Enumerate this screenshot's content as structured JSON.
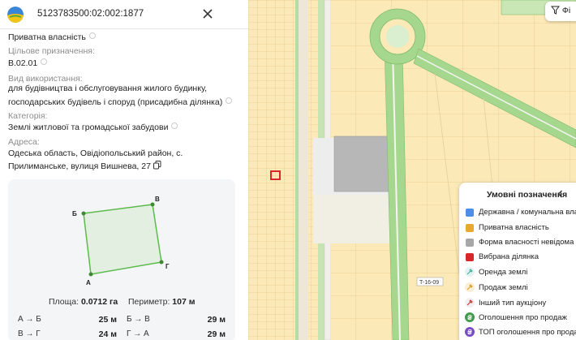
{
  "panel": {
    "cadastral_number": "5123783500:02:002:1877",
    "ownership": "Приватна власність",
    "purpose_label": "Цільове призначення:",
    "purpose_code": "В.02.01",
    "usage_label": "Вид використання:",
    "usage_line1": "для будівництва і обслуговування жилого будинку,",
    "usage_line2": "господарських будівель і споруд (присадибна ділянка)",
    "category_label": "Категорія:",
    "category_value": "Землі житлової та громадської забудови",
    "address_label": "Адреса:",
    "address_line1": "Одеська область, Овідіопольський район, с.",
    "address_line2": "Прилиманське, вулиця Вишнева, 27",
    "shape": {
      "vertices": [
        "Б",
        "В",
        "Г",
        "А"
      ],
      "area_label": "Площа:",
      "area_value": "0.0712 га",
      "perimeter_label": "Периметр:",
      "perimeter_value": "107 м",
      "sides": [
        {
          "label": "А → Б",
          "value": "25 м"
        },
        {
          "label": "Б → В",
          "value": "29 м"
        },
        {
          "label": "В → Г",
          "value": "24 м"
        },
        {
          "label": "Г → А",
          "value": "29 м"
        }
      ]
    }
  },
  "map": {
    "filter_label": "Фі",
    "road_label": "T-16-09",
    "colors": {
      "private": "#fbe9b8",
      "state": "#4d8ee8",
      "private_legend": "#e8a72e",
      "unknown": "#a7a7a7",
      "selected": "#d9262a",
      "road_green": "#9fd38a"
    }
  },
  "legend": {
    "title": "Умовні позначення",
    "items": [
      {
        "label": "Державна / комунальна власн",
        "icon": "square-blue"
      },
      {
        "label": "Приватна власність",
        "icon": "square-orange"
      },
      {
        "label": "Форма власності невідома",
        "icon": "square-gray"
      },
      {
        "label": "Вибрана ділянка",
        "icon": "square-red"
      },
      {
        "label": "Оренда землі",
        "icon": "rent-icon"
      },
      {
        "label": "Продаж землі",
        "icon": "sale-icon"
      },
      {
        "label": "Інший тип аукціону",
        "icon": "auction-icon"
      },
      {
        "label": "Оголошення про продаж",
        "icon": "hryvnia-green-icon"
      },
      {
        "label": "ТОП оголошення про продаж",
        "icon": "hryvnia-purple-icon"
      }
    ]
  }
}
